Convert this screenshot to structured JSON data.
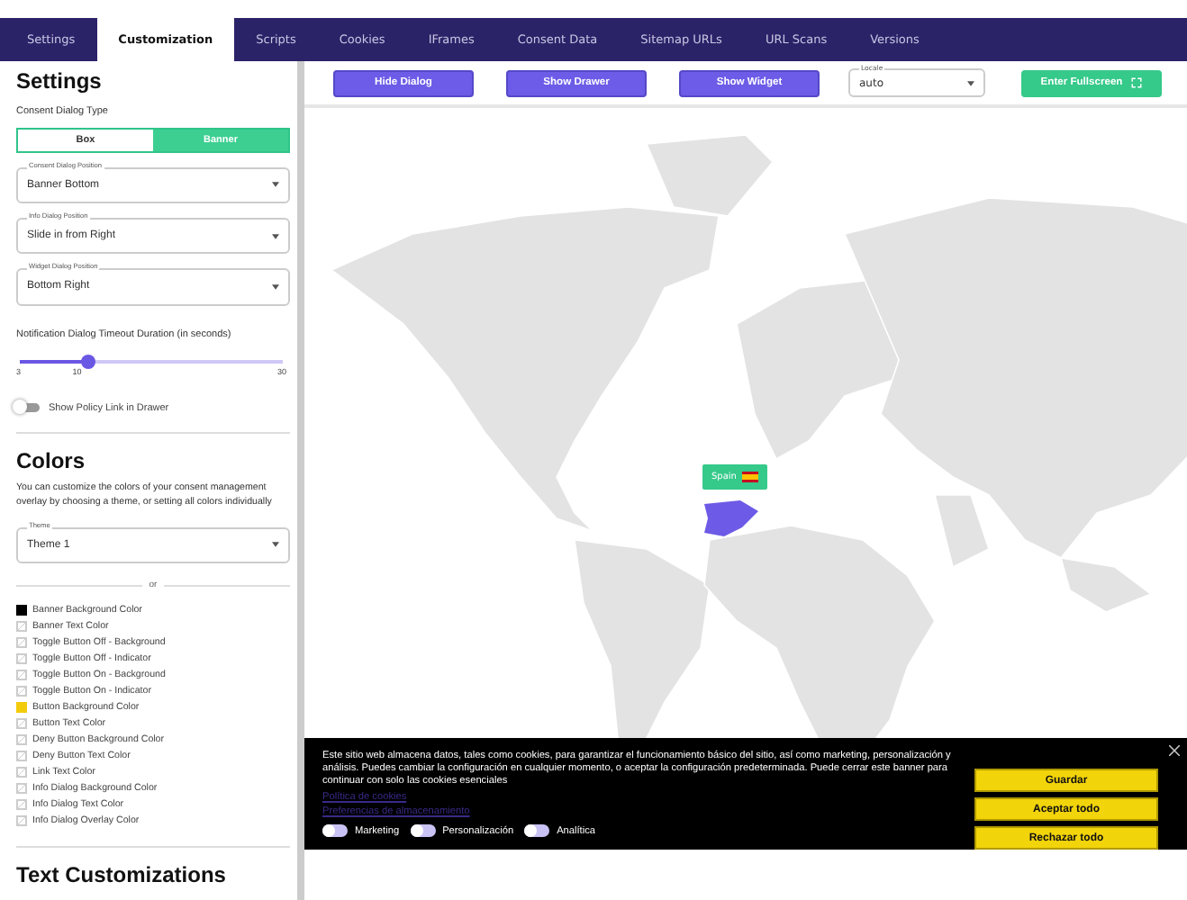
{
  "tabs": [
    {
      "label": "Settings",
      "selected": false
    },
    {
      "label": "Customization",
      "selected": true
    },
    {
      "label": "Scripts",
      "selected": false
    },
    {
      "label": "Cookies",
      "selected": false
    },
    {
      "label": "IFrames",
      "selected": false
    },
    {
      "label": "Consent Data",
      "selected": false
    },
    {
      "label": "Sitemap URLs",
      "selected": false
    },
    {
      "label": "URL Scans",
      "selected": false
    },
    {
      "label": "Versions",
      "selected": false
    }
  ],
  "sidebar": {
    "settings": {
      "heading": "Settings",
      "dialog_type_label": "Consent Dialog Type",
      "dialog_types": [
        {
          "label": "Box",
          "selected": false
        },
        {
          "label": "Banner",
          "selected": true
        }
      ],
      "selects": [
        {
          "label": "Consent Dialog Position",
          "value": "Banner Bottom"
        },
        {
          "label": "Info Dialog Position",
          "value": "Slide in from Right"
        },
        {
          "label": "Widget Dialog Position",
          "value": "Bottom Right"
        }
      ],
      "timeout": {
        "label": "Notification Dialog Timeout Duration (in seconds)",
        "level": 0.26,
        "ticks": [
          "3",
          "10",
          "30"
        ]
      },
      "policy_toggle": {
        "label": "Show Policy Link in Drawer",
        "on": false
      }
    },
    "colors": {
      "heading": "Colors",
      "description": "You can customize the colors of your consent management overlay by choosing a theme, or setting all colors individually",
      "theme": {
        "label": "Theme",
        "value": "Theme 1"
      },
      "separator": "or",
      "items": [
        {
          "label": "Banner Background Color",
          "color": "#000000"
        },
        {
          "label": "Banner Text Color"
        },
        {
          "label": "Toggle Button Off - Background"
        },
        {
          "label": "Toggle Button Off - Indicator"
        },
        {
          "label": "Toggle Button On - Background"
        },
        {
          "label": "Toggle Button On - Indicator"
        },
        {
          "label": "Button Background Color",
          "color": "#f2cc0c"
        },
        {
          "label": "Button Text Color"
        },
        {
          "label": "Deny Button Background Color"
        },
        {
          "label": "Deny Button Text Color"
        },
        {
          "label": "Link Text Color"
        },
        {
          "label": "Info Dialog Background Color"
        },
        {
          "label": "Info Dialog Text Color"
        },
        {
          "label": "Info Dialog Overlay Color"
        }
      ]
    },
    "text_heading": "Text Customizations"
  },
  "toolbar": {
    "buttons": [
      "Hide Dialog",
      "Show Drawer",
      "Show Widget"
    ],
    "locale": {
      "label": "Locale",
      "value": "auto"
    },
    "fullscreen": "Enter Fullscreen"
  },
  "map": {
    "tooltip": "Spain"
  },
  "banner": {
    "text": "Este sitio web almacena datos, tales como cookies, para garantizar el funcionamiento básico del sitio, así como marketing, personalización y análisis. Puedes cambiar la configuración en cualquier momento, o aceptar la configuración predeterminada. Puede cerrar este banner para continuar con solo las cookies esenciales",
    "links": [
      "Política de cookies",
      "Preferencias de almacenamiento"
    ],
    "toggles": [
      {
        "label": "Marketing",
        "on": false
      },
      {
        "label": "Personalización",
        "on": false
      },
      {
        "label": "Analítica",
        "on": false
      }
    ],
    "buttons": [
      "Guardar",
      "Aceptar todo",
      "Rechazar todo"
    ]
  }
}
